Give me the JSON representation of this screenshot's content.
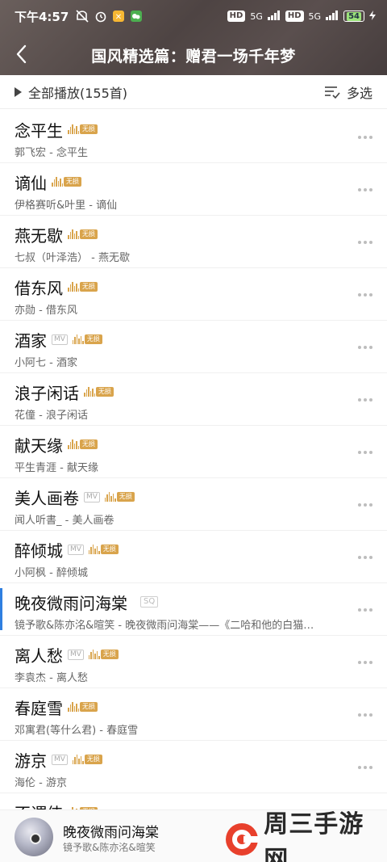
{
  "status_bar": {
    "time": "下午4:57",
    "network_left": "HD",
    "signal_1": "5G",
    "network_right": "HD",
    "signal_2": "5G",
    "battery": "54"
  },
  "header": {
    "title": "国风精选篇：赠君一场千年梦"
  },
  "toolbar": {
    "play_all": "全部播放(155首)",
    "multi_select": "多选"
  },
  "badges": {
    "lossless": "无损",
    "mv": "MV",
    "sq": "SQ"
  },
  "songs": [
    {
      "title": "念平生",
      "subtitle": "郭飞宏 - 念平生",
      "mv": false,
      "sq": false,
      "lossless": true
    },
    {
      "title": "谪仙",
      "subtitle": "伊格赛听&叶里 - 谪仙",
      "mv": false,
      "sq": false,
      "lossless": true
    },
    {
      "title": "燕无歇",
      "subtitle": "七叔（叶泽浩） - 燕无歇",
      "mv": false,
      "sq": false,
      "lossless": true
    },
    {
      "title": "借东风",
      "subtitle": "亦勋 - 借东风",
      "mv": false,
      "sq": false,
      "lossless": true
    },
    {
      "title": "酒家",
      "subtitle": "小阿七 - 酒家",
      "mv": true,
      "sq": false,
      "lossless": true
    },
    {
      "title": "浪子闲话",
      "subtitle": "花僮 - 浪子闲话",
      "mv": false,
      "sq": false,
      "lossless": true
    },
    {
      "title": "献天缘",
      "subtitle": "平生青涯 - 献天缘",
      "mv": false,
      "sq": false,
      "lossless": true
    },
    {
      "title": "美人画卷",
      "subtitle": "闻人听書_ - 美人画卷",
      "mv": true,
      "sq": false,
      "lossless": true
    },
    {
      "title": "醉倾城",
      "subtitle": "小阿枫 - 醉倾城",
      "mv": true,
      "sq": false,
      "lossless": true
    },
    {
      "title": "晚夜微雨问海棠",
      "subtitle": "镜予歌&陈亦洺&暄笑 - 晚夜微雨问海棠——《二哈和他的白猫…",
      "mv": false,
      "sq": true,
      "lossless": false,
      "active": true
    },
    {
      "title": "离人愁",
      "subtitle": "李袁杰 - 离人愁",
      "mv": true,
      "sq": false,
      "lossless": true
    },
    {
      "title": "春庭雪",
      "subtitle": "邓寓君(等什么君) - 春庭雪",
      "mv": false,
      "sq": false,
      "lossless": true
    },
    {
      "title": "游京",
      "subtitle": "海伦 - 游京",
      "mv": true,
      "sq": false,
      "lossless": true
    },
    {
      "title": "不谓侠",
      "subtitle": "",
      "mv": false,
      "sq": false,
      "lossless": true
    }
  ],
  "mini_player": {
    "title": "晚夜微雨问海棠",
    "artist": "镜予歌&陈亦洺&暄笑"
  },
  "watermark": {
    "text": "周三手游网"
  },
  "colors": {
    "header_bg": "#4e4443",
    "lossless_gold": "#d9a44c",
    "active_marker": "#2f7fe0",
    "watermark_red": "#e8402c"
  }
}
